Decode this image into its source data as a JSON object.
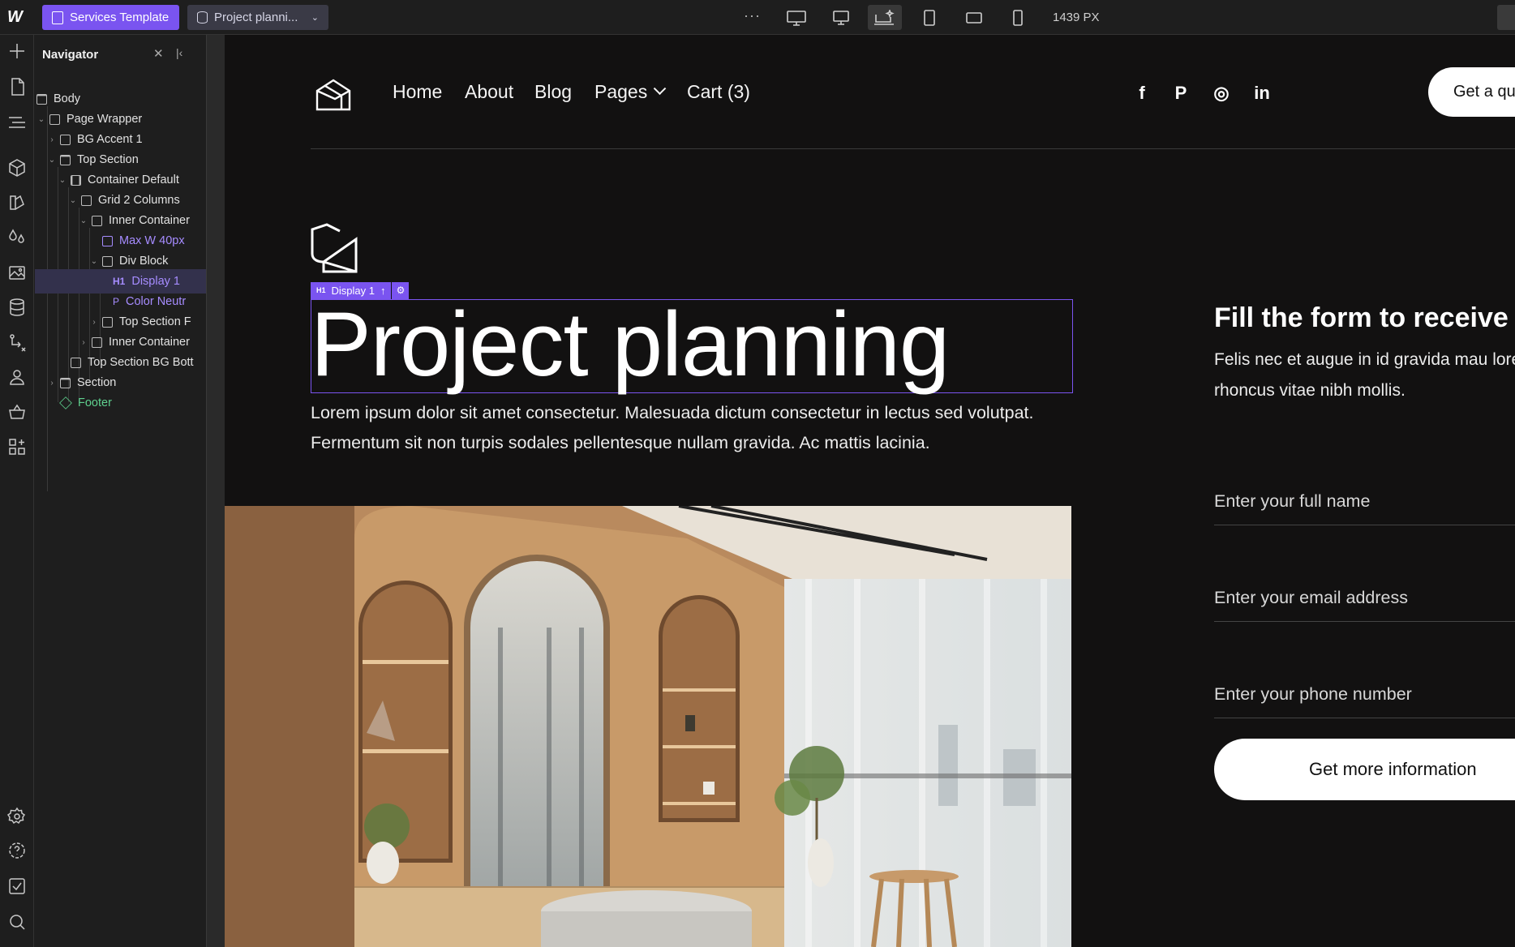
{
  "topbar": {
    "page_chip": "Services Template",
    "cms_chip": "Project planni...",
    "more": "···",
    "width_readout": "1439 PX"
  },
  "navigator": {
    "title": "Navigator",
    "items": [
      {
        "label": "Body"
      },
      {
        "label": "Page Wrapper"
      },
      {
        "label": "BG Accent 1"
      },
      {
        "label": "Top Section"
      },
      {
        "label": "Container Default"
      },
      {
        "label": "Grid 2 Columns"
      },
      {
        "label": "Inner Container"
      },
      {
        "label": "Max W 40px",
        "tag": ""
      },
      {
        "label": "Div Block"
      },
      {
        "label": "Display 1",
        "tag": "H1"
      },
      {
        "label": "Color Neutr",
        "tag": "P"
      },
      {
        "label": "Top Section F"
      },
      {
        "label": "Inner Container"
      },
      {
        "label": "Top Section BG Bott"
      },
      {
        "label": "Section"
      },
      {
        "label": "Footer"
      }
    ]
  },
  "site": {
    "menu": [
      "Home",
      "About",
      "Blog",
      "Pages",
      "Cart (3)"
    ],
    "social": [
      "f",
      "P",
      "◎",
      "in"
    ],
    "quote_button": "Get a qu",
    "selection": {
      "tag": "H1",
      "label": "Display 1"
    },
    "hero_title": "Project planning",
    "hero_text": "Lorem ipsum dolor sit amet consectetur. Malesuada dictum consectetur in lectus sed volutpat. Fermentum sit non turpis sodales pellentesque nullam gravida. Ac mattis lacinia.",
    "form_title": "Fill the form to receive c",
    "form_text": "Felis nec et augue in id gravida mau lorem rhoncus vitae nibh mollis.",
    "fields": [
      "Enter your full name",
      "Enter your email address",
      "Enter your phone number"
    ],
    "cta": "Get more information"
  },
  "colors": {
    "accent": "#7a54f0",
    "canvas_bg": "#121111",
    "component_green": "#5fd08e"
  }
}
